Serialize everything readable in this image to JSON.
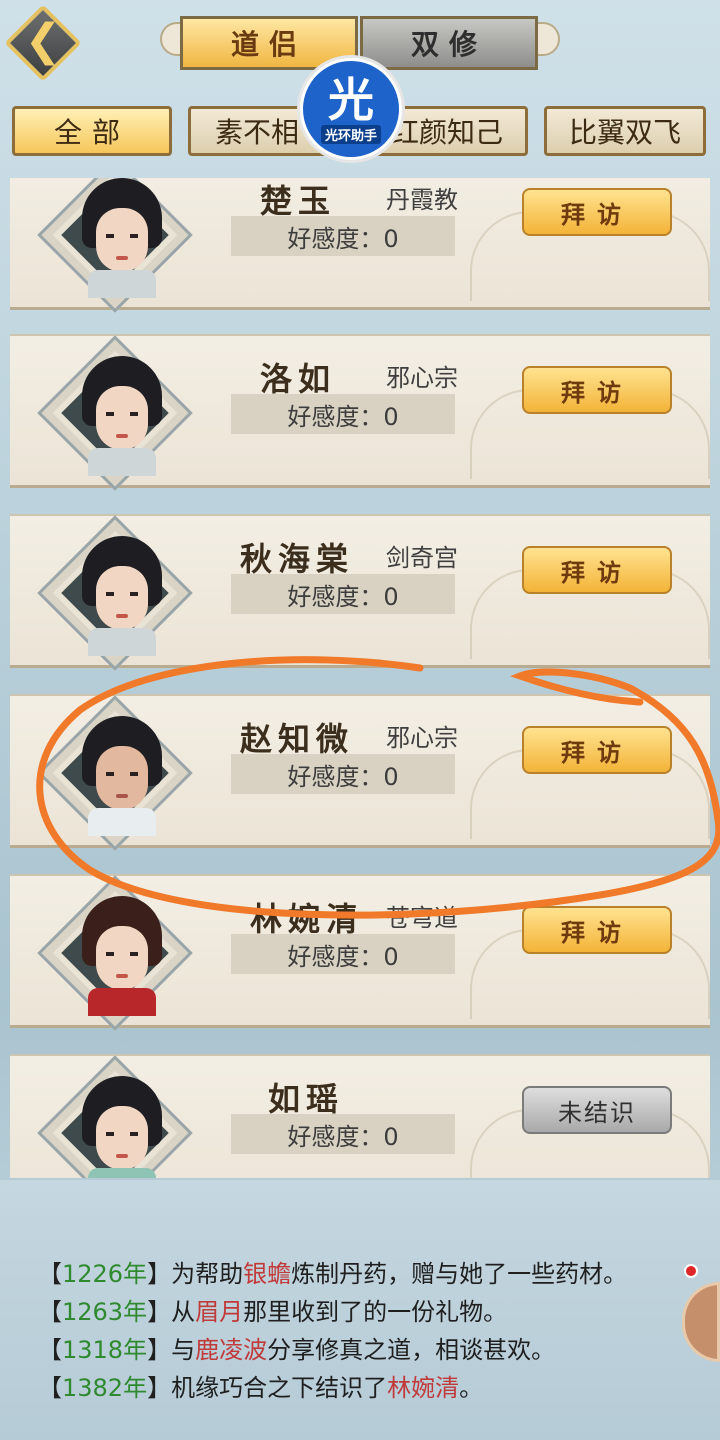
{
  "header": {
    "back_icon": "chevron-left-icon",
    "tabs": [
      {
        "label": "道侣",
        "active": true
      },
      {
        "label": "双修",
        "active": false
      }
    ],
    "logo": {
      "main": "光",
      "sub": "光环助手"
    }
  },
  "filters": [
    {
      "label": "全部",
      "active": true
    },
    {
      "label": "素不相",
      "active": false
    },
    {
      "label": "红颜知己",
      "active": false
    },
    {
      "label": "比翼双飞",
      "active": false
    }
  ],
  "companions": [
    {
      "name": "楚玉",
      "sect": "丹霞教",
      "favor": "好感度：0",
      "action": "拜访"
    },
    {
      "name": "洛如",
      "sect": "邪心宗",
      "favor": "好感度：0",
      "action": "拜访"
    },
    {
      "name": "秋海棠",
      "sect": "剑奇宫",
      "favor": "好感度：0",
      "action": "拜访"
    },
    {
      "name": "赵知微",
      "sect": "邪心宗",
      "favor": "好感度：0",
      "action": "拜访"
    },
    {
      "name": "林婉清",
      "sect": "苍穹道",
      "favor": "好感度：0",
      "action": "拜访"
    },
    {
      "name": "如瑶",
      "sect": "",
      "favor": "好感度：0",
      "action": "未结识"
    }
  ],
  "log": [
    {
      "open": "【",
      "year": "1226年",
      "close": "】",
      "pre": "为帮助",
      "name": "银蟾",
      "post": "炼制丹药，赠与她了一些药材。"
    },
    {
      "open": "【",
      "year": "1263年",
      "close": "】",
      "pre": "从",
      "name": "眉月",
      "post": "那里收到了的一份礼物。"
    },
    {
      "open": "【",
      "year": "1318年",
      "close": "】",
      "pre": "与",
      "name": "鹿凌波",
      "post": "分享修真之道，相谈甚欢。"
    },
    {
      "open": "【",
      "year": "1382年",
      "close": "】",
      "pre": "机缘巧合之下结识了",
      "name": "林婉清",
      "post": "。"
    }
  ],
  "colors": {
    "accent_gold": "#f3b338",
    "year_green": "#2f8a2f",
    "name_red": "#c03a3a",
    "annotation_orange": "#f07a2a"
  }
}
